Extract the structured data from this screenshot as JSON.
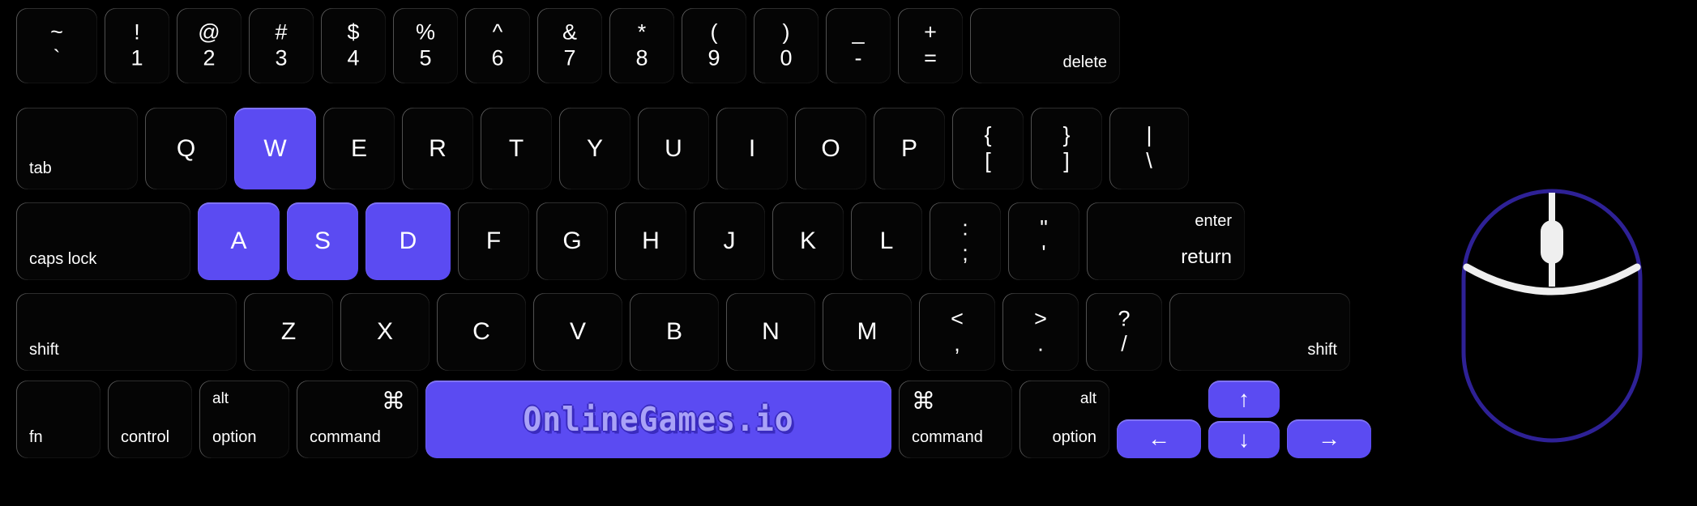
{
  "theme": {
    "background": "#000000",
    "key_face": "#050505",
    "key_text": "#ffffff",
    "highlight": "#5B4BF2",
    "logo_text": "#A9A2F7",
    "logo_outline": "#3A2BBF",
    "mouse_outline": "#2E2196"
  },
  "keyboard": {
    "rows": [
      {
        "name": "number-row",
        "keys": [
          {
            "name": "tilde",
            "top": "~",
            "bottom": "`",
            "highlighted": false
          },
          {
            "name": "1",
            "top": "!",
            "bottom": "1",
            "highlighted": false
          },
          {
            "name": "2",
            "top": "@",
            "bottom": "2",
            "highlighted": false
          },
          {
            "name": "3",
            "top": "#",
            "bottom": "3",
            "highlighted": false
          },
          {
            "name": "4",
            "top": "$",
            "bottom": "4",
            "highlighted": false
          },
          {
            "name": "5",
            "top": "%",
            "bottom": "5",
            "highlighted": false
          },
          {
            "name": "6",
            "top": "^",
            "bottom": "6",
            "highlighted": false
          },
          {
            "name": "7",
            "top": "&",
            "bottom": "7",
            "highlighted": false
          },
          {
            "name": "8",
            "top": "*",
            "bottom": "8",
            "highlighted": false
          },
          {
            "name": "9",
            "top": "(",
            "bottom": "9",
            "highlighted": false
          },
          {
            "name": "0",
            "top": ")",
            "bottom": "0",
            "highlighted": false
          },
          {
            "name": "minus",
            "top": "_",
            "bottom": "-",
            "highlighted": false
          },
          {
            "name": "equals",
            "top": "+",
            "bottom": "=",
            "highlighted": false
          },
          {
            "name": "delete",
            "word": "delete",
            "align": "br",
            "highlighted": false
          }
        ]
      },
      {
        "name": "tab-row",
        "keys": [
          {
            "name": "tab",
            "word": "tab",
            "align": "bl",
            "highlighted": false
          },
          {
            "name": "q",
            "letter": "Q",
            "highlighted": false
          },
          {
            "name": "w",
            "letter": "W",
            "highlighted": true
          },
          {
            "name": "e",
            "letter": "E",
            "highlighted": false
          },
          {
            "name": "r",
            "letter": "R",
            "highlighted": false
          },
          {
            "name": "t",
            "letter": "T",
            "highlighted": false
          },
          {
            "name": "y",
            "letter": "Y",
            "highlighted": false
          },
          {
            "name": "u",
            "letter": "U",
            "highlighted": false
          },
          {
            "name": "i",
            "letter": "I",
            "highlighted": false
          },
          {
            "name": "o",
            "letter": "O",
            "highlighted": false
          },
          {
            "name": "p",
            "letter": "P",
            "highlighted": false
          },
          {
            "name": "bracket-left",
            "top": "{",
            "bottom": "[",
            "highlighted": false
          },
          {
            "name": "bracket-right",
            "top": "}",
            "bottom": "]",
            "highlighted": false
          },
          {
            "name": "backslash",
            "top": "|",
            "bottom": "\\",
            "highlighted": false
          }
        ]
      },
      {
        "name": "home-row",
        "keys": [
          {
            "name": "caps-lock",
            "word": "caps lock",
            "align": "bl",
            "highlighted": false
          },
          {
            "name": "a",
            "letter": "A",
            "highlighted": true
          },
          {
            "name": "s",
            "letter": "S",
            "highlighted": true
          },
          {
            "name": "d",
            "letter": "D",
            "highlighted": true
          },
          {
            "name": "f",
            "letter": "F",
            "highlighted": false
          },
          {
            "name": "g",
            "letter": "G",
            "highlighted": false
          },
          {
            "name": "h",
            "letter": "H",
            "highlighted": false
          },
          {
            "name": "j",
            "letter": "J",
            "highlighted": false
          },
          {
            "name": "k",
            "letter": "K",
            "highlighted": false
          },
          {
            "name": "l",
            "letter": "L",
            "highlighted": false
          },
          {
            "name": "semicolon",
            "top": ":",
            "bottom": ";",
            "highlighted": false
          },
          {
            "name": "quote",
            "top": "\"",
            "bottom": "'",
            "highlighted": false
          },
          {
            "name": "enter-return",
            "word_top": "enter",
            "word_bottom": "return",
            "align": "br",
            "highlighted": false
          }
        ]
      },
      {
        "name": "shift-row",
        "keys": [
          {
            "name": "shift-left",
            "word": "shift",
            "align": "bl",
            "highlighted": false
          },
          {
            "name": "z",
            "letter": "Z",
            "highlighted": false
          },
          {
            "name": "x",
            "letter": "X",
            "highlighted": false
          },
          {
            "name": "c",
            "letter": "C",
            "highlighted": false
          },
          {
            "name": "v",
            "letter": "V",
            "highlighted": false
          },
          {
            "name": "b",
            "letter": "B",
            "highlighted": false
          },
          {
            "name": "n",
            "letter": "N",
            "highlighted": false
          },
          {
            "name": "m",
            "letter": "M",
            "highlighted": false
          },
          {
            "name": "comma",
            "top": "<",
            "bottom": ",",
            "highlighted": false
          },
          {
            "name": "period",
            "top": ">",
            "bottom": ".",
            "highlighted": false
          },
          {
            "name": "slash",
            "top": "?",
            "bottom": "/",
            "highlighted": false
          },
          {
            "name": "shift-right",
            "word": "shift",
            "align": "br",
            "highlighted": false
          }
        ]
      },
      {
        "name": "modifier-row",
        "keys": [
          {
            "name": "fn",
            "word": "fn",
            "align": "bl",
            "highlighted": false
          },
          {
            "name": "control",
            "word": "control",
            "align": "bl",
            "highlighted": false
          },
          {
            "name": "option-left",
            "word_small": "alt",
            "word": "option",
            "align": "bl",
            "highlighted": false
          },
          {
            "name": "command-left",
            "symbol": "⌘",
            "word": "command",
            "align": "bl",
            "highlighted": false
          },
          {
            "name": "spacebar",
            "logo": "OnlineGames.io",
            "highlighted": true
          },
          {
            "name": "command-right",
            "symbol": "⌘",
            "word": "command",
            "align": "bl",
            "highlighted": false
          },
          {
            "name": "option-right",
            "word_small": "alt",
            "word": "option",
            "align": "br",
            "highlighted": false
          },
          {
            "name": "arrow-left",
            "arrow": "←",
            "highlighted": true
          },
          {
            "name": "arrow-up",
            "arrow": "↑",
            "highlighted": true
          },
          {
            "name": "arrow-down",
            "arrow": "↓",
            "highlighted": true
          },
          {
            "name": "arrow-right",
            "arrow": "→",
            "highlighted": true
          }
        ]
      }
    ]
  },
  "mouse": {
    "name": "computer-mouse",
    "outline_color": "#2E2196",
    "detail_color": "#EFEFEF",
    "parts": [
      "left-button",
      "right-button",
      "scroll-wheel",
      "body"
    ]
  }
}
